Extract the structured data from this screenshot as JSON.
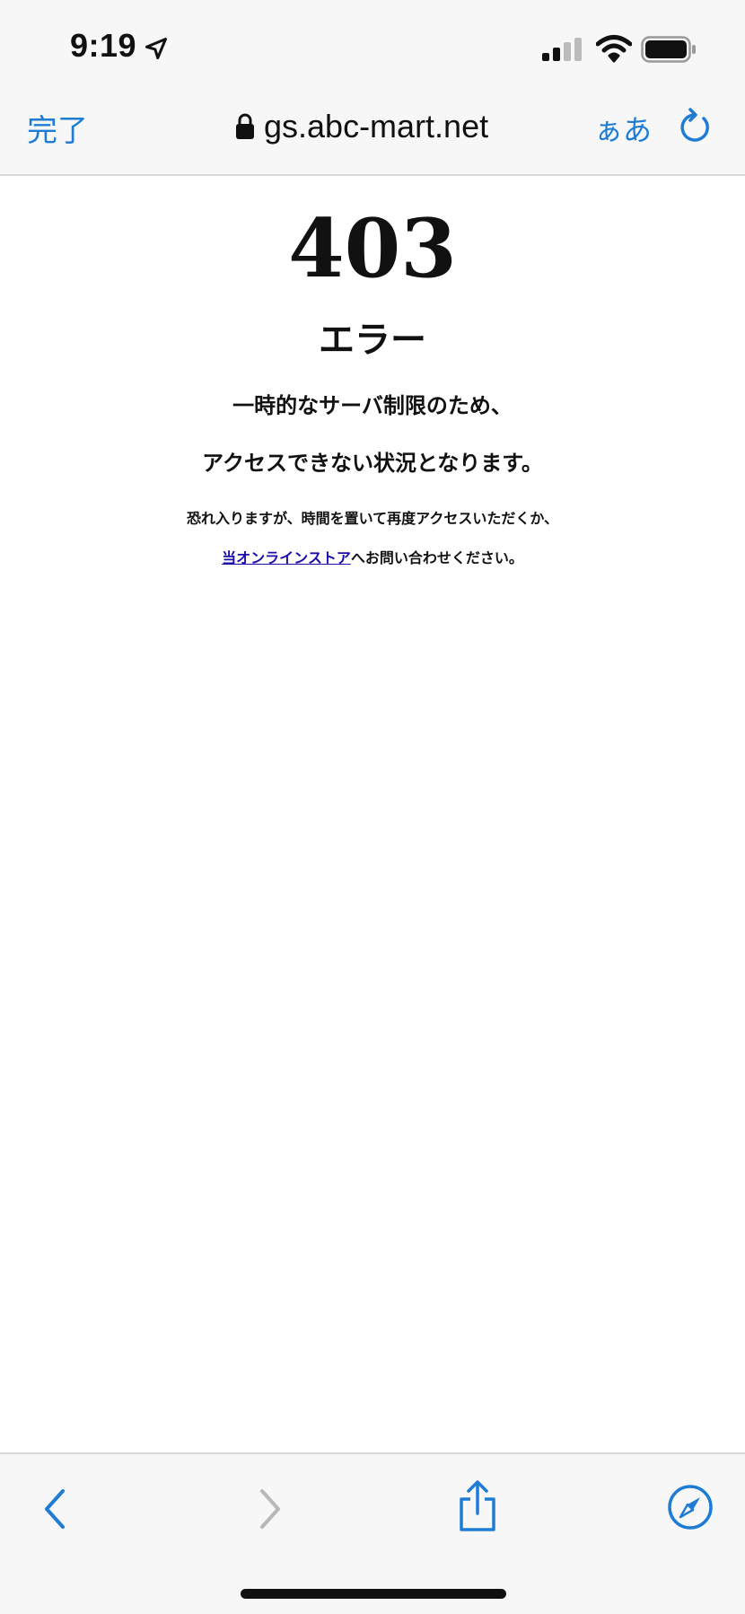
{
  "status_bar": {
    "time": "9:19",
    "icons": [
      "location-arrow-icon",
      "signal-icon",
      "wifi-icon",
      "battery-icon"
    ]
  },
  "toolbar": {
    "done_label": "完了",
    "url": "gs.abc-mart.net",
    "reader_label": "ぁあ",
    "accent_color": "#1e7cd4"
  },
  "page": {
    "code": "403",
    "title": "エラー",
    "message_line1": "一時的なサーバ制限のため、",
    "message_line2": "アクセスできない状況となります。",
    "note_line1": "恐れ入りますが、時間を置いて再度アクセスいただくか、",
    "store_link": "当オンラインストア",
    "note_line2_suffix": "へお問い合わせください。",
    "link_color": "#1a0dab"
  },
  "bottom_bar": {
    "icons": [
      "back-icon",
      "forward-icon",
      "share-icon",
      "safari-compass-icon"
    ]
  }
}
